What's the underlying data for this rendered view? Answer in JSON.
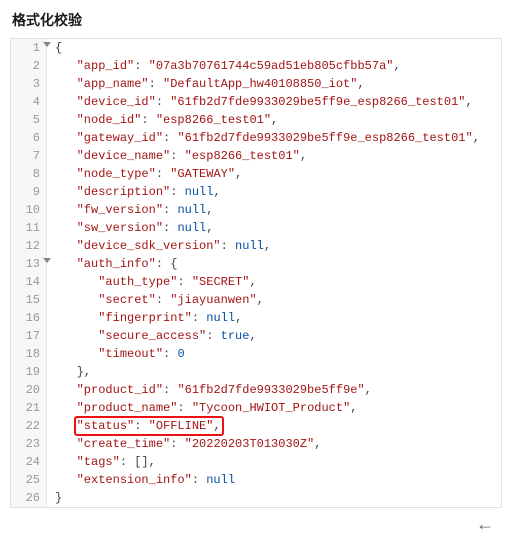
{
  "title": "格式化校验",
  "highlight_line": 22,
  "fold_lines": [
    1,
    13
  ],
  "chart_data": {
    "type": "table",
    "content": {
      "app_id": "07a3b70761744c59ad51eb805cfbb57a",
      "app_name": "DefaultApp_hw40108850_iot",
      "device_id": "61fb2d7fde9933029be5ff9e_esp8266_test01",
      "node_id": "esp8266_test01",
      "gateway_id": "61fb2d7fde9933029be5ff9e_esp8266_test01",
      "device_name": "esp8266_test01",
      "node_type": "GATEWAY",
      "description": null,
      "fw_version": null,
      "sw_version": null,
      "device_sdk_version": null,
      "auth_info": {
        "auth_type": "SECRET",
        "secret": "jiayuanwen",
        "fingerprint": null,
        "secure_access": true,
        "timeout": 0
      },
      "product_id": "61fb2d7fde9933029be5ff9e",
      "product_name": "Tycoon_HWIOT_Product",
      "status": "OFFLINE",
      "create_time": "20220203T013030Z",
      "tags": [],
      "extension_info": null
    }
  },
  "lines": [
    {
      "n": 1,
      "indent": 0,
      "tokens": [
        {
          "t": "{",
          "c": "p"
        }
      ]
    },
    {
      "n": 2,
      "indent": 1,
      "tokens": [
        {
          "t": "\"app_id\"",
          "c": "k"
        },
        {
          "t": ": ",
          "c": "p"
        },
        {
          "t": "\"07a3b70761744c59ad51eb805cfbb57a\"",
          "c": "s"
        },
        {
          "t": ",",
          "c": "p"
        }
      ]
    },
    {
      "n": 3,
      "indent": 1,
      "tokens": [
        {
          "t": "\"app_name\"",
          "c": "k"
        },
        {
          "t": ": ",
          "c": "p"
        },
        {
          "t": "\"DefaultApp_hw40108850_iot\"",
          "c": "s"
        },
        {
          "t": ",",
          "c": "p"
        }
      ]
    },
    {
      "n": 4,
      "indent": 1,
      "tokens": [
        {
          "t": "\"device_id\"",
          "c": "k"
        },
        {
          "t": ": ",
          "c": "p"
        },
        {
          "t": "\"61fb2d7fde9933029be5ff9e_esp8266_test01\"",
          "c": "s"
        },
        {
          "t": ",",
          "c": "p"
        }
      ]
    },
    {
      "n": 5,
      "indent": 1,
      "tokens": [
        {
          "t": "\"node_id\"",
          "c": "k"
        },
        {
          "t": ": ",
          "c": "p"
        },
        {
          "t": "\"esp8266_test01\"",
          "c": "s"
        },
        {
          "t": ",",
          "c": "p"
        }
      ]
    },
    {
      "n": 6,
      "indent": 1,
      "tokens": [
        {
          "t": "\"gateway_id\"",
          "c": "k"
        },
        {
          "t": ": ",
          "c": "p"
        },
        {
          "t": "\"61fb2d7fde9933029be5ff9e_esp8266_test01\"",
          "c": "s"
        },
        {
          "t": ",",
          "c": "p"
        }
      ]
    },
    {
      "n": 7,
      "indent": 1,
      "tokens": [
        {
          "t": "\"device_name\"",
          "c": "k"
        },
        {
          "t": ": ",
          "c": "p"
        },
        {
          "t": "\"esp8266_test01\"",
          "c": "s"
        },
        {
          "t": ",",
          "c": "p"
        }
      ]
    },
    {
      "n": 8,
      "indent": 1,
      "tokens": [
        {
          "t": "\"node_type\"",
          "c": "k"
        },
        {
          "t": ": ",
          "c": "p"
        },
        {
          "t": "\"GATEWAY\"",
          "c": "s"
        },
        {
          "t": ",",
          "c": "p"
        }
      ]
    },
    {
      "n": 9,
      "indent": 1,
      "tokens": [
        {
          "t": "\"description\"",
          "c": "k"
        },
        {
          "t": ": ",
          "c": "p"
        },
        {
          "t": "null",
          "c": "n"
        },
        {
          "t": ",",
          "c": "p"
        }
      ]
    },
    {
      "n": 10,
      "indent": 1,
      "tokens": [
        {
          "t": "\"fw_version\"",
          "c": "k"
        },
        {
          "t": ": ",
          "c": "p"
        },
        {
          "t": "null",
          "c": "n"
        },
        {
          "t": ",",
          "c": "p"
        }
      ]
    },
    {
      "n": 11,
      "indent": 1,
      "tokens": [
        {
          "t": "\"sw_version\"",
          "c": "k"
        },
        {
          "t": ": ",
          "c": "p"
        },
        {
          "t": "null",
          "c": "n"
        },
        {
          "t": ",",
          "c": "p"
        }
      ]
    },
    {
      "n": 12,
      "indent": 1,
      "tokens": [
        {
          "t": "\"device_sdk_version\"",
          "c": "k"
        },
        {
          "t": ": ",
          "c": "p"
        },
        {
          "t": "null",
          "c": "n"
        },
        {
          "t": ",",
          "c": "p"
        }
      ]
    },
    {
      "n": 13,
      "indent": 1,
      "tokens": [
        {
          "t": "\"auth_info\"",
          "c": "k"
        },
        {
          "t": ": {",
          "c": "p"
        }
      ]
    },
    {
      "n": 14,
      "indent": 2,
      "tokens": [
        {
          "t": "\"auth_type\"",
          "c": "k"
        },
        {
          "t": ": ",
          "c": "p"
        },
        {
          "t": "\"SECRET\"",
          "c": "s"
        },
        {
          "t": ",",
          "c": "p"
        }
      ]
    },
    {
      "n": 15,
      "indent": 2,
      "tokens": [
        {
          "t": "\"secret\"",
          "c": "k"
        },
        {
          "t": ": ",
          "c": "p"
        },
        {
          "t": "\"jiayuanwen\"",
          "c": "s"
        },
        {
          "t": ",",
          "c": "p"
        }
      ]
    },
    {
      "n": 16,
      "indent": 2,
      "tokens": [
        {
          "t": "\"fingerprint\"",
          "c": "k"
        },
        {
          "t": ": ",
          "c": "p"
        },
        {
          "t": "null",
          "c": "n"
        },
        {
          "t": ",",
          "c": "p"
        }
      ]
    },
    {
      "n": 17,
      "indent": 2,
      "tokens": [
        {
          "t": "\"secure_access\"",
          "c": "k"
        },
        {
          "t": ": ",
          "c": "p"
        },
        {
          "t": "true",
          "c": "n"
        },
        {
          "t": ",",
          "c": "p"
        }
      ]
    },
    {
      "n": 18,
      "indent": 2,
      "tokens": [
        {
          "t": "\"timeout\"",
          "c": "k"
        },
        {
          "t": ": ",
          "c": "p"
        },
        {
          "t": "0",
          "c": "n"
        }
      ]
    },
    {
      "n": 19,
      "indent": 1,
      "tokens": [
        {
          "t": "},",
          "c": "p"
        }
      ]
    },
    {
      "n": 20,
      "indent": 1,
      "tokens": [
        {
          "t": "\"product_id\"",
          "c": "k"
        },
        {
          "t": ": ",
          "c": "p"
        },
        {
          "t": "\"61fb2d7fde9933029be5ff9e\"",
          "c": "s"
        },
        {
          "t": ",",
          "c": "p"
        }
      ]
    },
    {
      "n": 21,
      "indent": 1,
      "tokens": [
        {
          "t": "\"product_name\"",
          "c": "k"
        },
        {
          "t": ": ",
          "c": "p"
        },
        {
          "t": "\"Tycoon_HWIOT_Product\"",
          "c": "s"
        },
        {
          "t": ",",
          "c": "p"
        }
      ]
    },
    {
      "n": 22,
      "indent": 1,
      "tokens": [
        {
          "t": "\"status\"",
          "c": "k"
        },
        {
          "t": ": ",
          "c": "p"
        },
        {
          "t": "\"OFFLINE\"",
          "c": "s"
        },
        {
          "t": ",",
          "c": "p"
        }
      ]
    },
    {
      "n": 23,
      "indent": 1,
      "tokens": [
        {
          "t": "\"create_time\"",
          "c": "k"
        },
        {
          "t": ": ",
          "c": "p"
        },
        {
          "t": "\"20220203T013030Z\"",
          "c": "s"
        },
        {
          "t": ",",
          "c": "p"
        }
      ]
    },
    {
      "n": 24,
      "indent": 1,
      "tokens": [
        {
          "t": "\"tags\"",
          "c": "k"
        },
        {
          "t": ": [],",
          "c": "p"
        }
      ]
    },
    {
      "n": 25,
      "indent": 1,
      "tokens": [
        {
          "t": "\"extension_info\"",
          "c": "k"
        },
        {
          "t": ": ",
          "c": "p"
        },
        {
          "t": "null",
          "c": "n"
        }
      ]
    },
    {
      "n": 26,
      "indent": 0,
      "tokens": [
        {
          "t": "}",
          "c": "p"
        }
      ]
    }
  ],
  "footer_icon": "←"
}
